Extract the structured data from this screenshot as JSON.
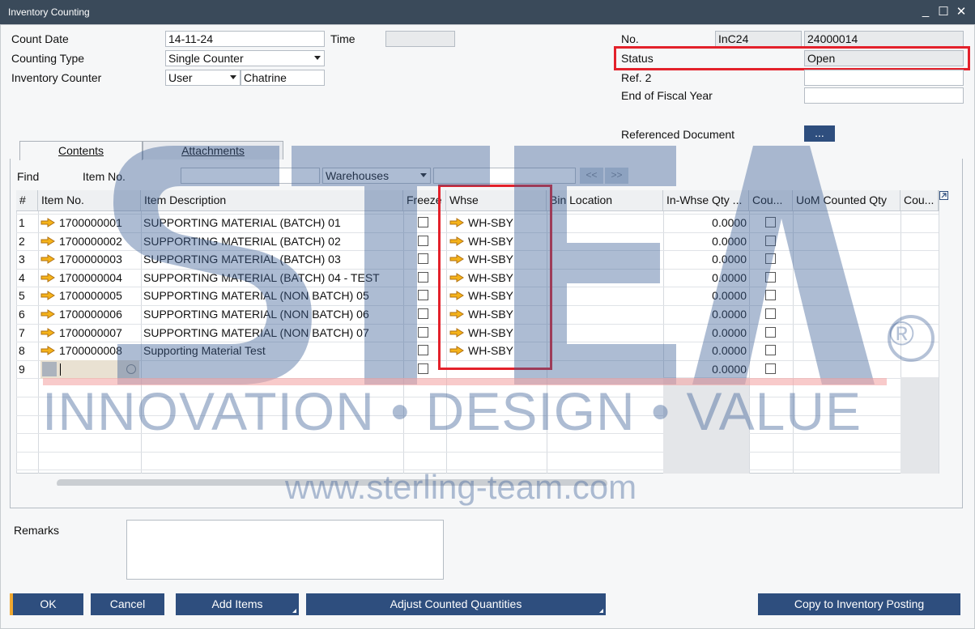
{
  "window": {
    "title": "Inventory Counting",
    "controls": [
      "_",
      "☐",
      "✕"
    ]
  },
  "header_left": {
    "count_date": {
      "label": "Count Date",
      "value": "14-11-24"
    },
    "time": {
      "label": "Time",
      "value": ""
    },
    "counting_type": {
      "label": "Counting Type",
      "value": "Single Counter"
    },
    "inventory_counter": {
      "label": "Inventory Counter",
      "type": "User",
      "name": "Chatrine"
    }
  },
  "header_right": {
    "no": {
      "label": "No.",
      "series": "InC24",
      "value": "24000014"
    },
    "status": {
      "label": "Status",
      "value": "Open"
    },
    "ref2": {
      "label": "Ref. 2",
      "value": ""
    },
    "end_fiscal": {
      "label": "End of Fiscal Year",
      "value": ""
    },
    "referenced_document": {
      "label": "Referenced Document",
      "button": "..."
    }
  },
  "tabs": [
    {
      "label": "Contents",
      "active": true
    },
    {
      "label": "Attachments",
      "active": false
    }
  ],
  "find": {
    "label": "Find",
    "field_label": "Item No.",
    "value": "",
    "warehouse_select": "Warehouses",
    "warehouse_value": "",
    "prev": "<<",
    "next": ">>"
  },
  "grid": {
    "columns": [
      "#",
      "Item No.",
      "Item Description",
      "Freeze",
      "Whse",
      "Bin Location",
      "In-Whse Qty ...",
      "Cou...",
      "UoM Counted Qty",
      "Cou..."
    ],
    "rows": [
      {
        "num": "1",
        "item": "1700000001",
        "desc": "SUPPORTING MATERIAL (BATCH) 01",
        "whse": "WH-SBY",
        "qty": "0.0000"
      },
      {
        "num": "2",
        "item": "1700000002",
        "desc": "SUPPORTING MATERIAL (BATCH) 02",
        "whse": "WH-SBY",
        "qty": "0.0000"
      },
      {
        "num": "3",
        "item": "1700000003",
        "desc": "SUPPORTING MATERIAL (BATCH) 03",
        "whse": "WH-SBY",
        "qty": "0.0000"
      },
      {
        "num": "4",
        "item": "1700000004",
        "desc": "SUPPORTING MATERIAL (BATCH) 04 - TEST",
        "whse": "WH-SBY",
        "qty": "0.0000"
      },
      {
        "num": "5",
        "item": "1700000005",
        "desc": "SUPPORTING MATERIAL (NON BATCH) 05",
        "whse": "WH-SBY",
        "qty": "0.0000"
      },
      {
        "num": "6",
        "item": "1700000006",
        "desc": "SUPPORTING MATERIAL (NON BATCH) 06",
        "whse": "WH-SBY",
        "qty": "0.0000"
      },
      {
        "num": "7",
        "item": "1700000007",
        "desc": "SUPPORTING MATERIAL (NON BATCH) 07",
        "whse": "WH-SBY",
        "qty": "0.0000"
      },
      {
        "num": "8",
        "item": "1700000008",
        "desc": "Supporting Material Test",
        "whse": "WH-SBY",
        "qty": "0.0000"
      },
      {
        "num": "9",
        "item": "",
        "desc": "",
        "whse": "",
        "qty": "0.0000"
      }
    ]
  },
  "watermark": {
    "brand": "STEAM",
    "registered": "®",
    "tagline": "INNOVATION • DESIGN • VALUE",
    "url": "www.sterling-team.com"
  },
  "remarks": {
    "label": "Remarks",
    "value": ""
  },
  "buttons": {
    "ok": "OK",
    "cancel": "Cancel",
    "add_items": "Add Items",
    "adjust": "Adjust Counted Quantities",
    "copy": "Copy to Inventory Posting"
  },
  "colors": {
    "accent": "#2e4e7e",
    "highlight": "#e3212b",
    "watermark": "#3c5f97",
    "orange": "#e79a1d"
  }
}
